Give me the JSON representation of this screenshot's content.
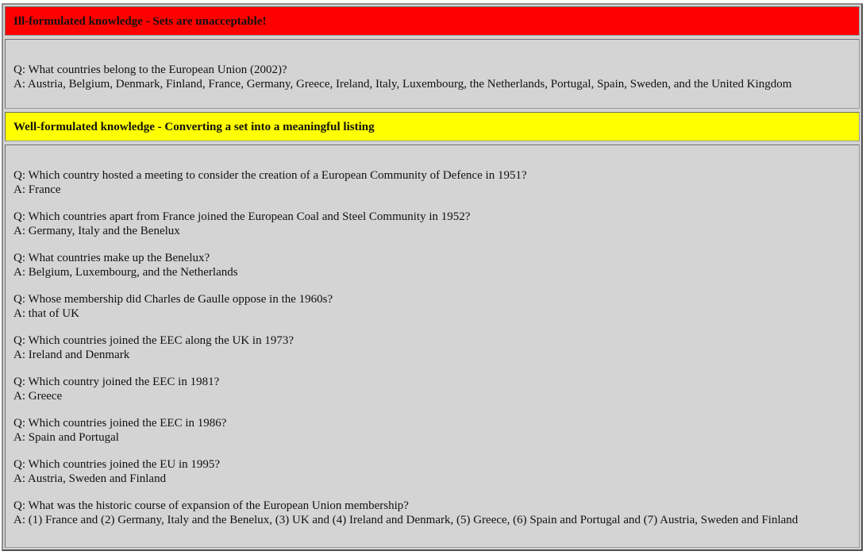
{
  "sections": [
    {
      "title": "Ill-formulated knowledge - Sets are unacceptable!",
      "color": "#ff0000",
      "items": [
        {
          "q": "Q: What countries belong to the European Union (2002)?",
          "a": "A: Austria, Belgium, Denmark, Finland, France, Germany, Greece, Ireland, Italy, Luxembourg, the Netherlands, Portugal, Spain, Sweden, and the United Kingdom"
        }
      ]
    },
    {
      "title": "Well-formulated knowledge - Converting a set into a meaningful listing",
      "color": "#ffff00",
      "items": [
        {
          "q": "Q: Which country hosted a meeting to consider the creation of a European Community of Defence in 1951?",
          "a": "A: France"
        },
        {
          "q": "Q: Which countries apart from France joined the European Coal and Steel Community in 1952?",
          "a": "A: Germany, Italy and the Benelux"
        },
        {
          "q": "Q: What countries make up the Benelux?",
          "a": "A: Belgium, Luxembourg, and the Netherlands"
        },
        {
          "q": "Q: Whose membership did Charles de Gaulle oppose in the 1960s?",
          "a": "A: that of UK"
        },
        {
          "q": "Q: Which countries joined the EEC along the UK in 1973?",
          "a": "A: Ireland and Denmark"
        },
        {
          "q": "Q: Which country joined the EEC in 1981?",
          "a": "A: Greece"
        },
        {
          "q": "Q: Which countries joined the EEC in 1986?",
          "a": "A: Spain and Portugal"
        },
        {
          "q": "Q: Which countries joined the EU in 1995?",
          "a": "A: Austria, Sweden and Finland"
        },
        {
          "q": "Q: What was the historic course of expansion of the European Union membership?",
          "a": "A: (1) France and (2) Germany, Italy and the Benelux, (3) UK and (4) Ireland and Denmark, (5) Greece, (6) Spain and Portugal and (7) Austria, Sweden and Finland"
        }
      ]
    }
  ]
}
